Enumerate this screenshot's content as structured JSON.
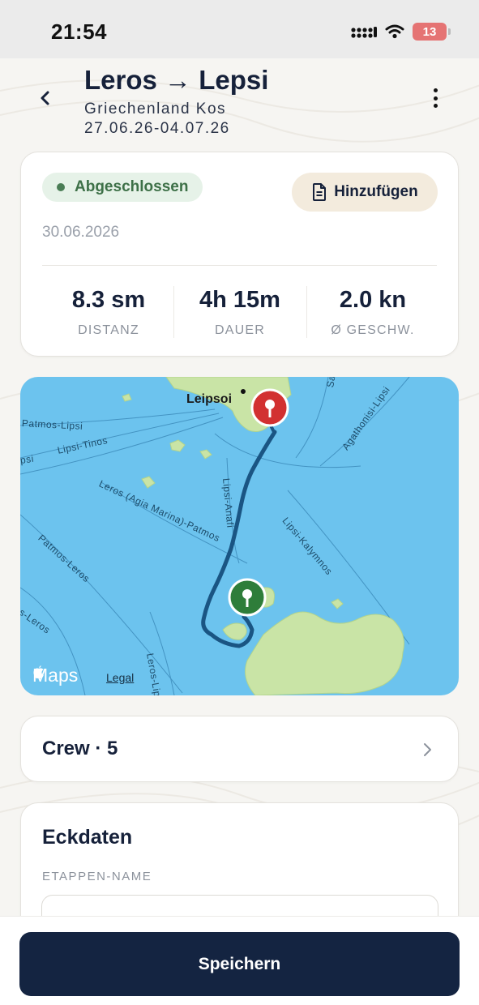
{
  "status_bar": {
    "time": "21:54",
    "battery": "13"
  },
  "header": {
    "title": "Leros → Lepsi",
    "region": "Griechenland Kos",
    "dates": "27.06.26-04.07.26"
  },
  "stats": {
    "status": "Abgeschlossen",
    "add_label": "Hinzufügen",
    "date": "30.06.2026",
    "items": [
      {
        "value": "8.3 sm",
        "label": "DISTANZ"
      },
      {
        "value": "4h 15m",
        "label": "DAUER"
      },
      {
        "value": "2.0 kn",
        "label": "Ø GESCHW."
      }
    ],
    "colors": {
      "completed": "#4a7d55",
      "accent": "#142441"
    }
  },
  "map": {
    "place": "Leipsoi",
    "routes": [
      "Patmos-Lipsi",
      "Lipsi-Tinos",
      "Leros (Agia Marina)-Patmos",
      "Patmos-Leros",
      "Lipsi-Anafi",
      "Lipsi-Kalymnos",
      "Agathonisi-Lipsi",
      "Leros-Lipsi",
      "Sam",
      "s-Leros",
      "psi"
    ],
    "provider": "Maps",
    "legal": "Legal",
    "start_pin": "green",
    "end_pin": "red"
  },
  "crew": {
    "label": "Crew · 5"
  },
  "eckdaten": {
    "title": "Eckdaten",
    "field_label": "ETAPPEN-NAME",
    "field_value": ""
  },
  "actions": {
    "save": "Speichern"
  }
}
